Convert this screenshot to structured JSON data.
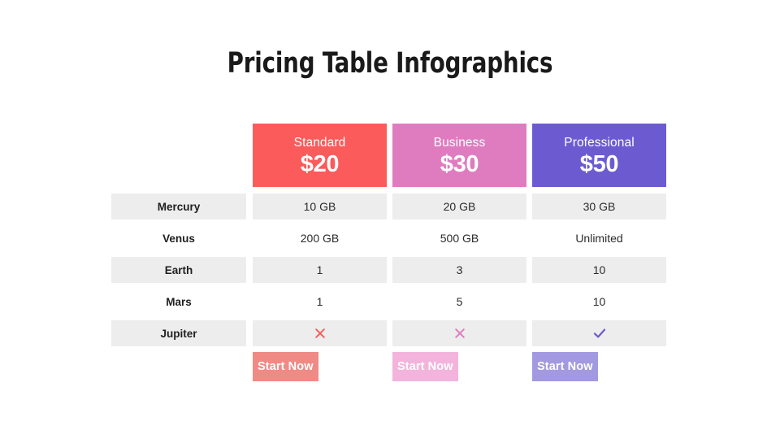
{
  "page": {
    "title": "Pricing Table Infographics",
    "background_color": "#FFFFFF"
  },
  "plans": [
    {
      "name": "Standard",
      "price": "$20",
      "header_color": "#FB5B5B",
      "cta_label": "Start Now",
      "cta_color": "#F08A85"
    },
    {
      "name": "Business",
      "price": "$30",
      "header_color": "#DF7CC0",
      "cta_label": "Start Now",
      "cta_color": "#F2B4DC"
    },
    {
      "name": "Professional",
      "price": "$50",
      "header_color": "#6C5BD0",
      "cta_label": "Start Now",
      "cta_color": "#A399E0"
    }
  ],
  "rows": [
    {
      "label": "Mercury",
      "shaded": true,
      "values": [
        "10 GB",
        "20 GB",
        "30 GB"
      ],
      "value_types": [
        "text",
        "text",
        "text"
      ]
    },
    {
      "label": "Venus",
      "shaded": false,
      "values": [
        "200 GB",
        "500 GB",
        "Unlimited"
      ],
      "value_types": [
        "text",
        "text",
        "text"
      ]
    },
    {
      "label": "Earth",
      "shaded": true,
      "values": [
        "1",
        "3",
        "10"
      ],
      "value_types": [
        "text",
        "text",
        "text"
      ]
    },
    {
      "label": "Mars",
      "shaded": false,
      "values": [
        "1",
        "5",
        "10"
      ],
      "value_types": [
        "text",
        "text",
        "text"
      ]
    },
    {
      "label": "Jupiter",
      "shaded": true,
      "values": [
        "cross-icon",
        "cross-icon",
        "check-icon"
      ],
      "value_types": [
        "icon",
        "icon",
        "icon"
      ],
      "icon_colors": [
        "#F2605D",
        "#E07BC0",
        "#6C5BD0"
      ]
    }
  ],
  "palette": {
    "row_shade": "#EDEDED",
    "text_dark": "#2B2B2B",
    "title_color": "#1A1A1A"
  }
}
